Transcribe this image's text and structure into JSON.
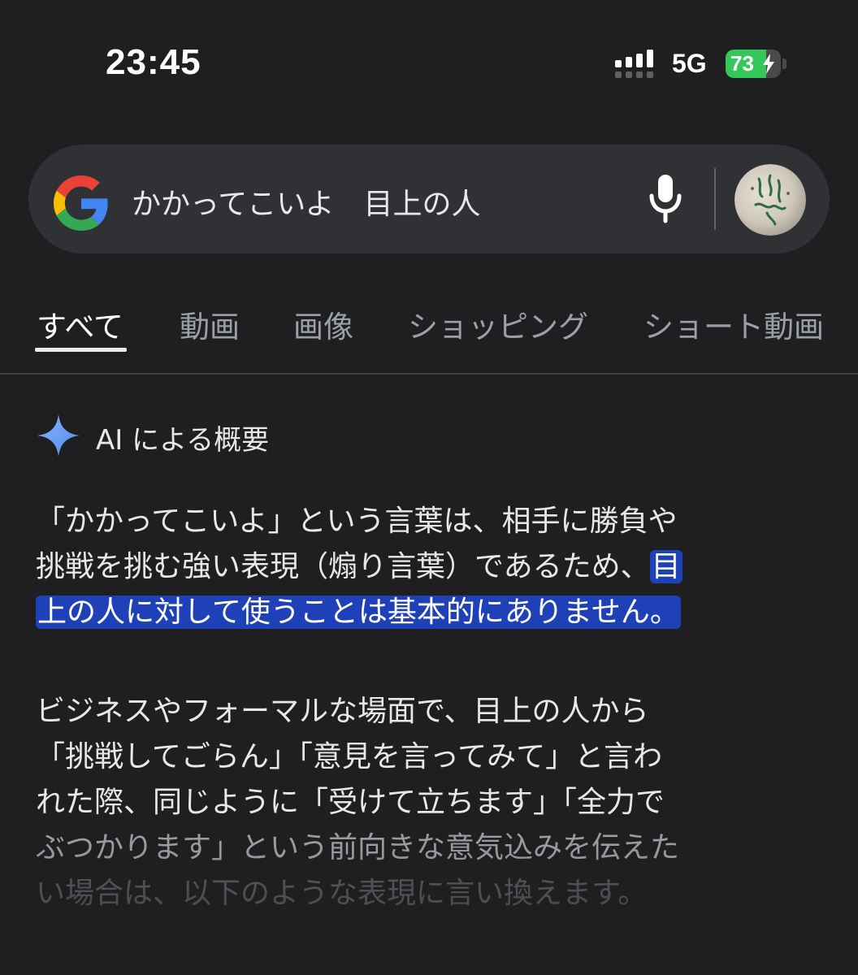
{
  "status_bar": {
    "time": "23:45",
    "network": "5G",
    "battery_percent": "73",
    "battery_level": 0.73,
    "battery_color": "#34c759"
  },
  "search": {
    "query": "かかってこいよ　目上の人",
    "logo_icon": "google-g-icon",
    "mic_icon": "microphone-icon"
  },
  "tabs": [
    {
      "label": "すべて",
      "active": true
    },
    {
      "label": "動画",
      "active": false
    },
    {
      "label": "画像",
      "active": false
    },
    {
      "label": "ショッピング",
      "active": false
    },
    {
      "label": "ショート動画",
      "active": false
    }
  ],
  "ai_overview": {
    "title": "AI による概要",
    "icon": "sparkle-icon",
    "highlight_color": "#1f41b8",
    "paragraph1": {
      "line1": "「かかってこいよ」という言葉は、相手に勝負や",
      "line2_plain": "挑戦を挑む強い表現（煽り言葉）であるため、",
      "line2_highlight": "目",
      "line3_highlight": "上の人に対して使うことは基本的にありません。"
    },
    "paragraph2": {
      "line1": "ビジネスやフォーマルな場面で、目上の人から",
      "line2": "「挑戦してごらん」「意見を言ってみて」と言わ",
      "line3": "れた際、同じように「受けて立ちます」「全力で",
      "line4": "ぶつかります」という前向きな意気込みを伝えた",
      "line5": "い場合は、以下のような表現に言い換えます。"
    }
  }
}
